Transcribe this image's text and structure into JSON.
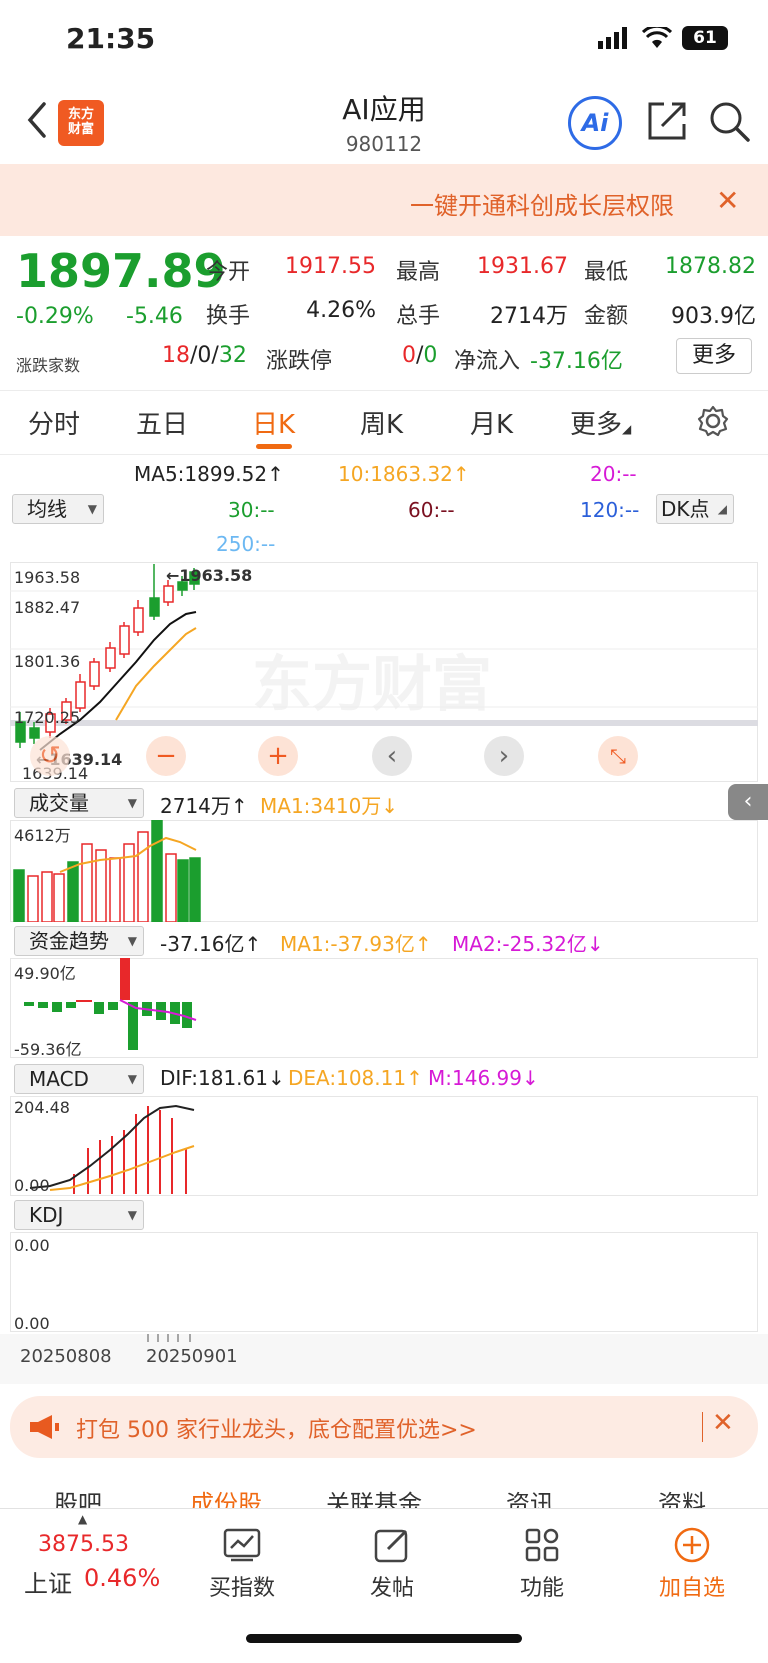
{
  "status": {
    "time": "21:35",
    "battery": "61"
  },
  "header": {
    "title": "AI应用",
    "code": "980112",
    "logo_line1": "东方",
    "logo_line2": "财富"
  },
  "banner": {
    "text": "一键开通科创成长层权限",
    "close": "✕"
  },
  "quote": {
    "price": "1897.89",
    "pct": "-0.29%",
    "change": "-5.46",
    "open_label": "今开",
    "open": "1917.55",
    "high_label": "最高",
    "high": "1931.67",
    "low_label": "最低",
    "low": "1878.82",
    "turnover_label": "换手",
    "turnover": "4.26%",
    "volume_label": "总手",
    "volume": "2714万",
    "amount_label": "金额",
    "amount": "903.9亿",
    "breadth_label": "涨跌家数",
    "up": "18",
    "flat": "0",
    "down": "32",
    "limit_label": "涨跌停",
    "limit_up": "0",
    "limit_down": "0",
    "netflow_label": "净流入",
    "netflow": "-37.16亿",
    "more": "更多",
    "slash": "/"
  },
  "tabs": [
    "分时",
    "五日",
    "日K",
    "周K",
    "月K",
    "更多"
  ],
  "ma": {
    "ma5": "MA5:1899.52↑",
    "ma10": "10:1863.32↑",
    "ma20": "20:--",
    "ma30": "30:--",
    "ma60": "60:--",
    "ma120": "120:--",
    "ma250": "250:--",
    "select": "均线",
    "dk": "DK点"
  },
  "kline": {
    "labels": [
      "1963.58",
      "1882.47",
      "1801.36",
      "1720.25",
      "1639.14"
    ],
    "max_tag": "←1963.58",
    "min_tag": "←1639.14",
    "watermark": "东方财富"
  },
  "volume": {
    "select": "成交量",
    "value": "2714万↑",
    "ma1": "MA1:3410万↓",
    "top": "4612万"
  },
  "flow": {
    "select": "资金趋势",
    "value": "-37.16亿↑",
    "ma1": "MA1:-37.93亿↑",
    "ma2": "MA2:-25.32亿↓",
    "top": "49.90亿",
    "bottom": "-59.36亿"
  },
  "macd": {
    "select": "MACD",
    "dif": "DIF:181.61↓",
    "dea": "DEA:108.11↑",
    "m": "M:146.99↓",
    "top": "204.48",
    "bottom": "0.00"
  },
  "kdj": {
    "select": "KDJ",
    "top": "0.00",
    "bottom": "0.00"
  },
  "dates": [
    "20250808",
    "20250901"
  ],
  "ad": {
    "text": "打包 500 家行业龙头，底仓配置优选>>",
    "close": "✕"
  },
  "subtabs": [
    "股吧",
    "成份股",
    "关联基金",
    "资讯",
    "资料"
  ],
  "nav": {
    "index_value": "3875.53",
    "index_name": "上证",
    "index_pct": "0.46%",
    "items": [
      "买指数",
      "发帖",
      "功能",
      "加自选"
    ]
  },
  "colors": {
    "up": "#e8282a",
    "down": "#1b9e2e",
    "accent": "#f06a12",
    "ma10": "#f5a623",
    "ma20": "#d61ad6"
  }
}
